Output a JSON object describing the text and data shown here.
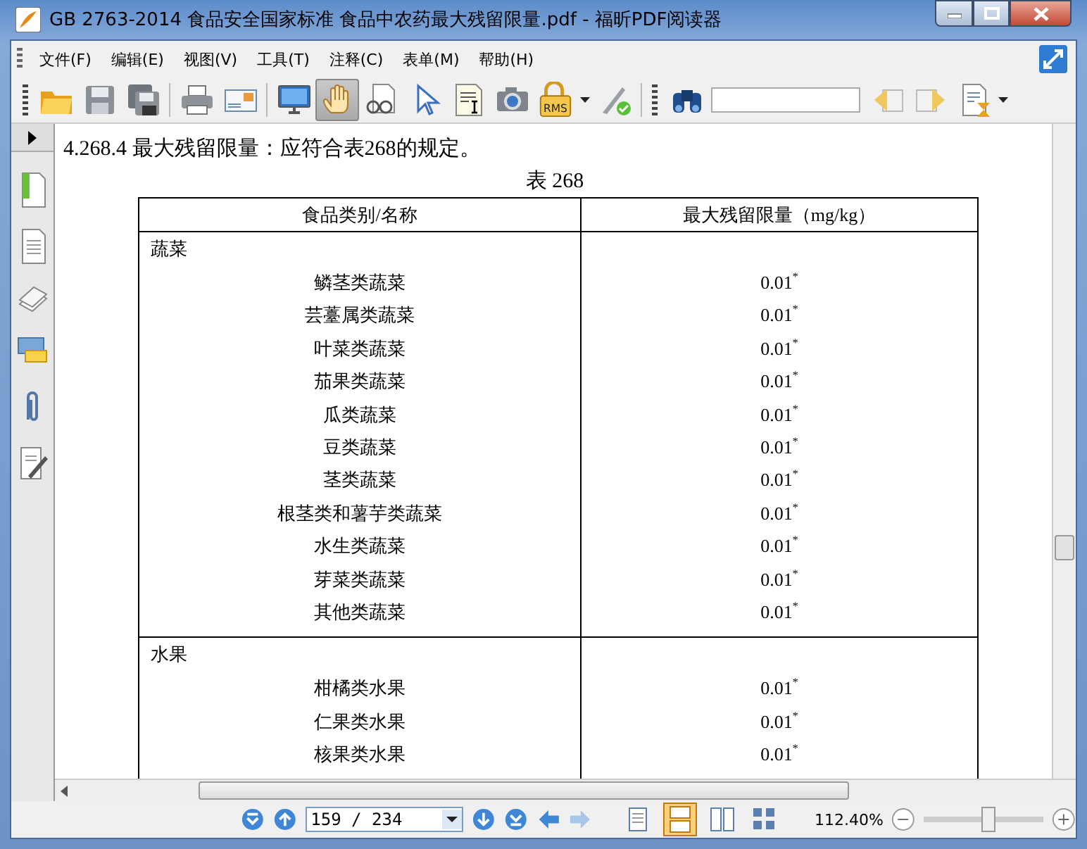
{
  "window": {
    "title": "GB 2763-2014 食品安全国家标准 食品中农药最大残留限量.pdf - 福昕PDF阅读器"
  },
  "menu": [
    "文件(F)",
    "编辑(E)",
    "视图(V)",
    "工具(T)",
    "注释(C)",
    "表单(M)",
    "帮助(H)"
  ],
  "toolbar": {
    "tools": [
      {
        "selected": false
      },
      {
        "selected": false
      },
      {
        "selected": false
      },
      {
        "selected": false
      },
      {
        "selected": false
      },
      {
        "selected": false
      },
      {
        "selected": true
      },
      {
        "selected": false
      },
      {
        "selected": false
      },
      {
        "selected": false
      },
      {
        "selected": false
      },
      {
        "selected": false
      }
    ],
    "rms_label": "RMS"
  },
  "document": {
    "paragraph": "4.268.4  最大残留限量：应符合表268的规定。",
    "caption": "表 268",
    "table": {
      "columns": [
        "食品类别/名称",
        "最大残留限量（mg/kg）"
      ],
      "groups": [
        {
          "name": "蔬菜",
          "rows": [
            {
              "name": "鳞茎类蔬菜",
              "value": "0.01$^{*}$"
            },
            {
              "name": "芸薹属类蔬菜",
              "value": "0.01$^{*}$"
            },
            {
              "name": "叶菜类蔬菜",
              "value": "0.01$^{*}$"
            },
            {
              "name": "茄果类蔬菜",
              "value": "0.01$^{*}$"
            },
            {
              "name": "瓜类蔬菜",
              "value": "0.01$^{*}$"
            },
            {
              "name": "豆类蔬菜",
              "value": "0.01$^{*}$"
            },
            {
              "name": "茎类蔬菜",
              "value": "0.01$^{*}$"
            },
            {
              "name": "根茎类和薯芋类蔬菜",
              "value": "0.01$^{*}$"
            },
            {
              "name": "水生类蔬菜",
              "value": "0.01$^{*}$"
            },
            {
              "name": "芽菜类蔬菜",
              "value": "0.01$^{*}$"
            },
            {
              "name": "其他类蔬菜",
              "value": "0.01$^{*}$"
            }
          ]
        },
        {
          "name": "水果",
          "rows": [
            {
              "name": "柑橘类水果",
              "value": "0.01$^{*}$"
            },
            {
              "name": "仁果类水果",
              "value": "0.01$^{*}$"
            },
            {
              "name": "核果类水果",
              "value": "0.01$^{*}$"
            }
          ]
        }
      ]
    }
  },
  "status_bar": {
    "page": "159 / 234",
    "zoom": "112.40%",
    "zoom_slider": {
      "level": 0.5
    },
    "views": [
      {
        "selected": false
      },
      {
        "selected": true
      },
      {
        "selected": false
      },
      {
        "selected": false
      }
    ]
  }
}
